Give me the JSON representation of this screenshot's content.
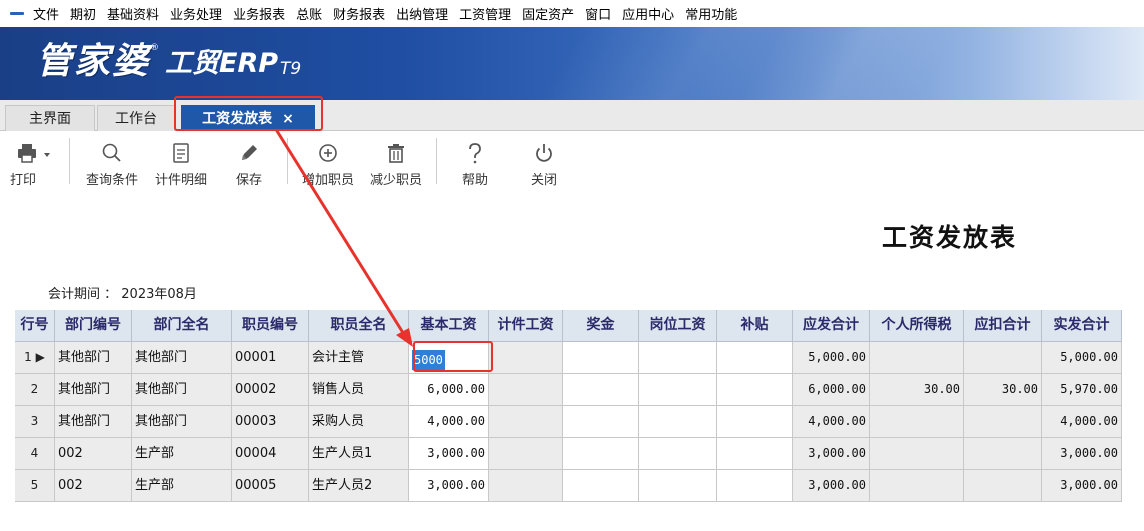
{
  "menu": [
    "文件",
    "期初",
    "基础资料",
    "业务处理",
    "业务报表",
    "总账",
    "财务报表",
    "出纳管理",
    "工资管理",
    "固定资产",
    "窗口",
    "应用中心",
    "常用功能"
  ],
  "banner": {
    "logo_main": "管家婆",
    "reg_mark": "®",
    "logo_sub": "工贸ERP",
    "logo_ver": "T9"
  },
  "tabs": [
    {
      "label": "主界面"
    },
    {
      "label": "工作台"
    },
    {
      "label": "工资发放表",
      "close": "×"
    }
  ],
  "toolbar": {
    "print": "打印",
    "query": "查询条件",
    "piece_detail": "计件明细",
    "save": "保存",
    "add_staff": "增加职员",
    "remove_staff": "减少职员",
    "help": "帮助",
    "close": "关闭"
  },
  "report": {
    "title": "工资发放表",
    "period_label": "会计期间 ：",
    "period_value": "2023年08月"
  },
  "table": {
    "headers": [
      "行号",
      "部门编号",
      "部门全名",
      "职员编号",
      "职员全名",
      "基本工资",
      "计件工资",
      "奖金",
      "岗位工资",
      "补贴",
      "应发合计",
      "个人所得税",
      "应扣合计",
      "实发合计"
    ],
    "rows": [
      [
        "1",
        "其他部门",
        "其他部门",
        "00001",
        "会计主管",
        "5000",
        "",
        "",
        "",
        "",
        "5,000.00",
        "",
        "",
        "5,000.00"
      ],
      [
        "2",
        "其他部门",
        "其他部门",
        "00002",
        "销售人员",
        "6,000.00",
        "",
        "",
        "",
        "",
        "6,000.00",
        "30.00",
        "30.00",
        "5,970.00"
      ],
      [
        "3",
        "其他部门",
        "其他部门",
        "00003",
        "采购人员",
        "4,000.00",
        "",
        "",
        "",
        "",
        "4,000.00",
        "",
        "",
        "4,000.00"
      ],
      [
        "4",
        "002",
        "生产部",
        "00004",
        "生产人员1",
        "3,000.00",
        "",
        "",
        "",
        "",
        "3,000.00",
        "",
        "",
        "3,000.00"
      ],
      [
        "5",
        "002",
        "生产部",
        "00005",
        "生产人员2",
        "3,000.00",
        "",
        "",
        "",
        "",
        "3,000.00",
        "",
        "",
        "3,000.00"
      ]
    ],
    "current_row_marker": "▶"
  },
  "colors": {
    "accent": "#1f58a8",
    "highlight_red": "#e8322c",
    "selection": "#2f7fd6"
  }
}
